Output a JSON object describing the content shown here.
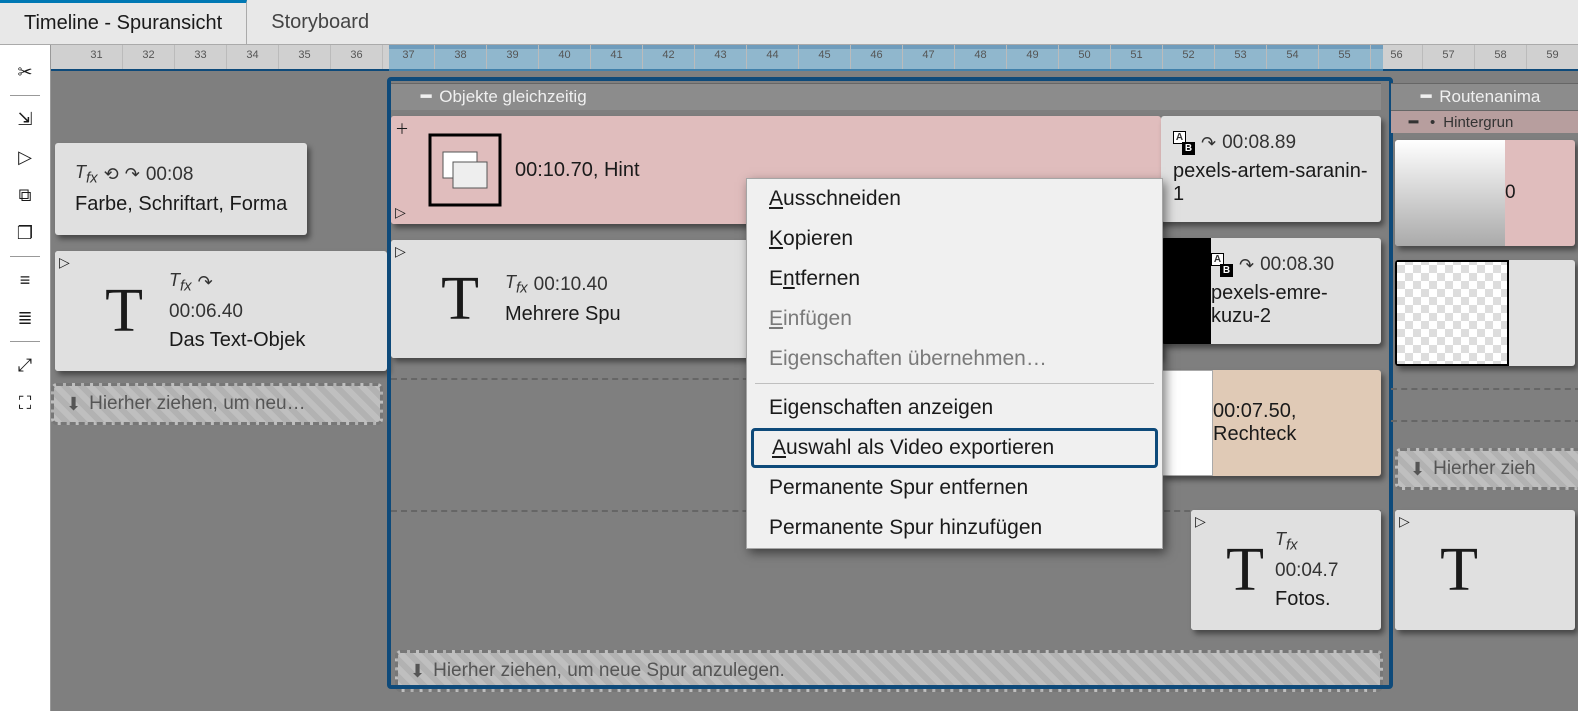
{
  "tabs": {
    "timeline": "Timeline - Spuransicht",
    "storyboard": "Storyboard"
  },
  "ruler": {
    "start": 31,
    "end": 55,
    "extra": [
      "36",
      "37",
      "38",
      "39"
    ]
  },
  "chapters": {
    "left_clip1": {
      "time": "00:08",
      "name": "Farbe, Schriftart, Forma"
    },
    "left_clip2": {
      "time": "00:06.40",
      "name": "Das Text-Objek"
    },
    "main_title": "Objekte gleichzeitig",
    "main_clip1": {
      "time": "00:10.70",
      "name_prefix": ", Hint"
    },
    "main_clip2": {
      "time": "00:10.40",
      "name": "Mehrere Spu"
    },
    "right_col": {
      "clip1": {
        "time": "00:08.89",
        "name": "pexels-artem-saranin-1"
      },
      "clip2": {
        "time": "00:08.30",
        "name": "pexels-emre-kuzu-2"
      },
      "clip3": {
        "time": "00:07.50",
        "name": ", Rechteck"
      },
      "clip4": {
        "time": "00:04.7",
        "name": "Fotos."
      }
    },
    "far_right": {
      "route_title": "Routenanima",
      "bg_title": "Hintergrun"
    }
  },
  "drop_lane_short": "Hierher ziehen, um neu…",
  "drop_lane_main": "Hierher ziehen, um neue Spur anzulegen.",
  "drop_lane_far": "Hierher zieh",
  "ctx_menu": {
    "cut": "Ausschneiden",
    "copy": "Kopieren",
    "remove": "Entfernen",
    "paste": "Einfügen",
    "inherit_props": "Eigenschaften übernehmen…",
    "show_props": "Eigenschaften anzeigen",
    "export_sel": "Auswahl als Video exportieren",
    "perm_remove": "Permanente Spur entfernen",
    "perm_add": "Permanente Spur hinzufügen"
  },
  "prefix_zero": "0"
}
